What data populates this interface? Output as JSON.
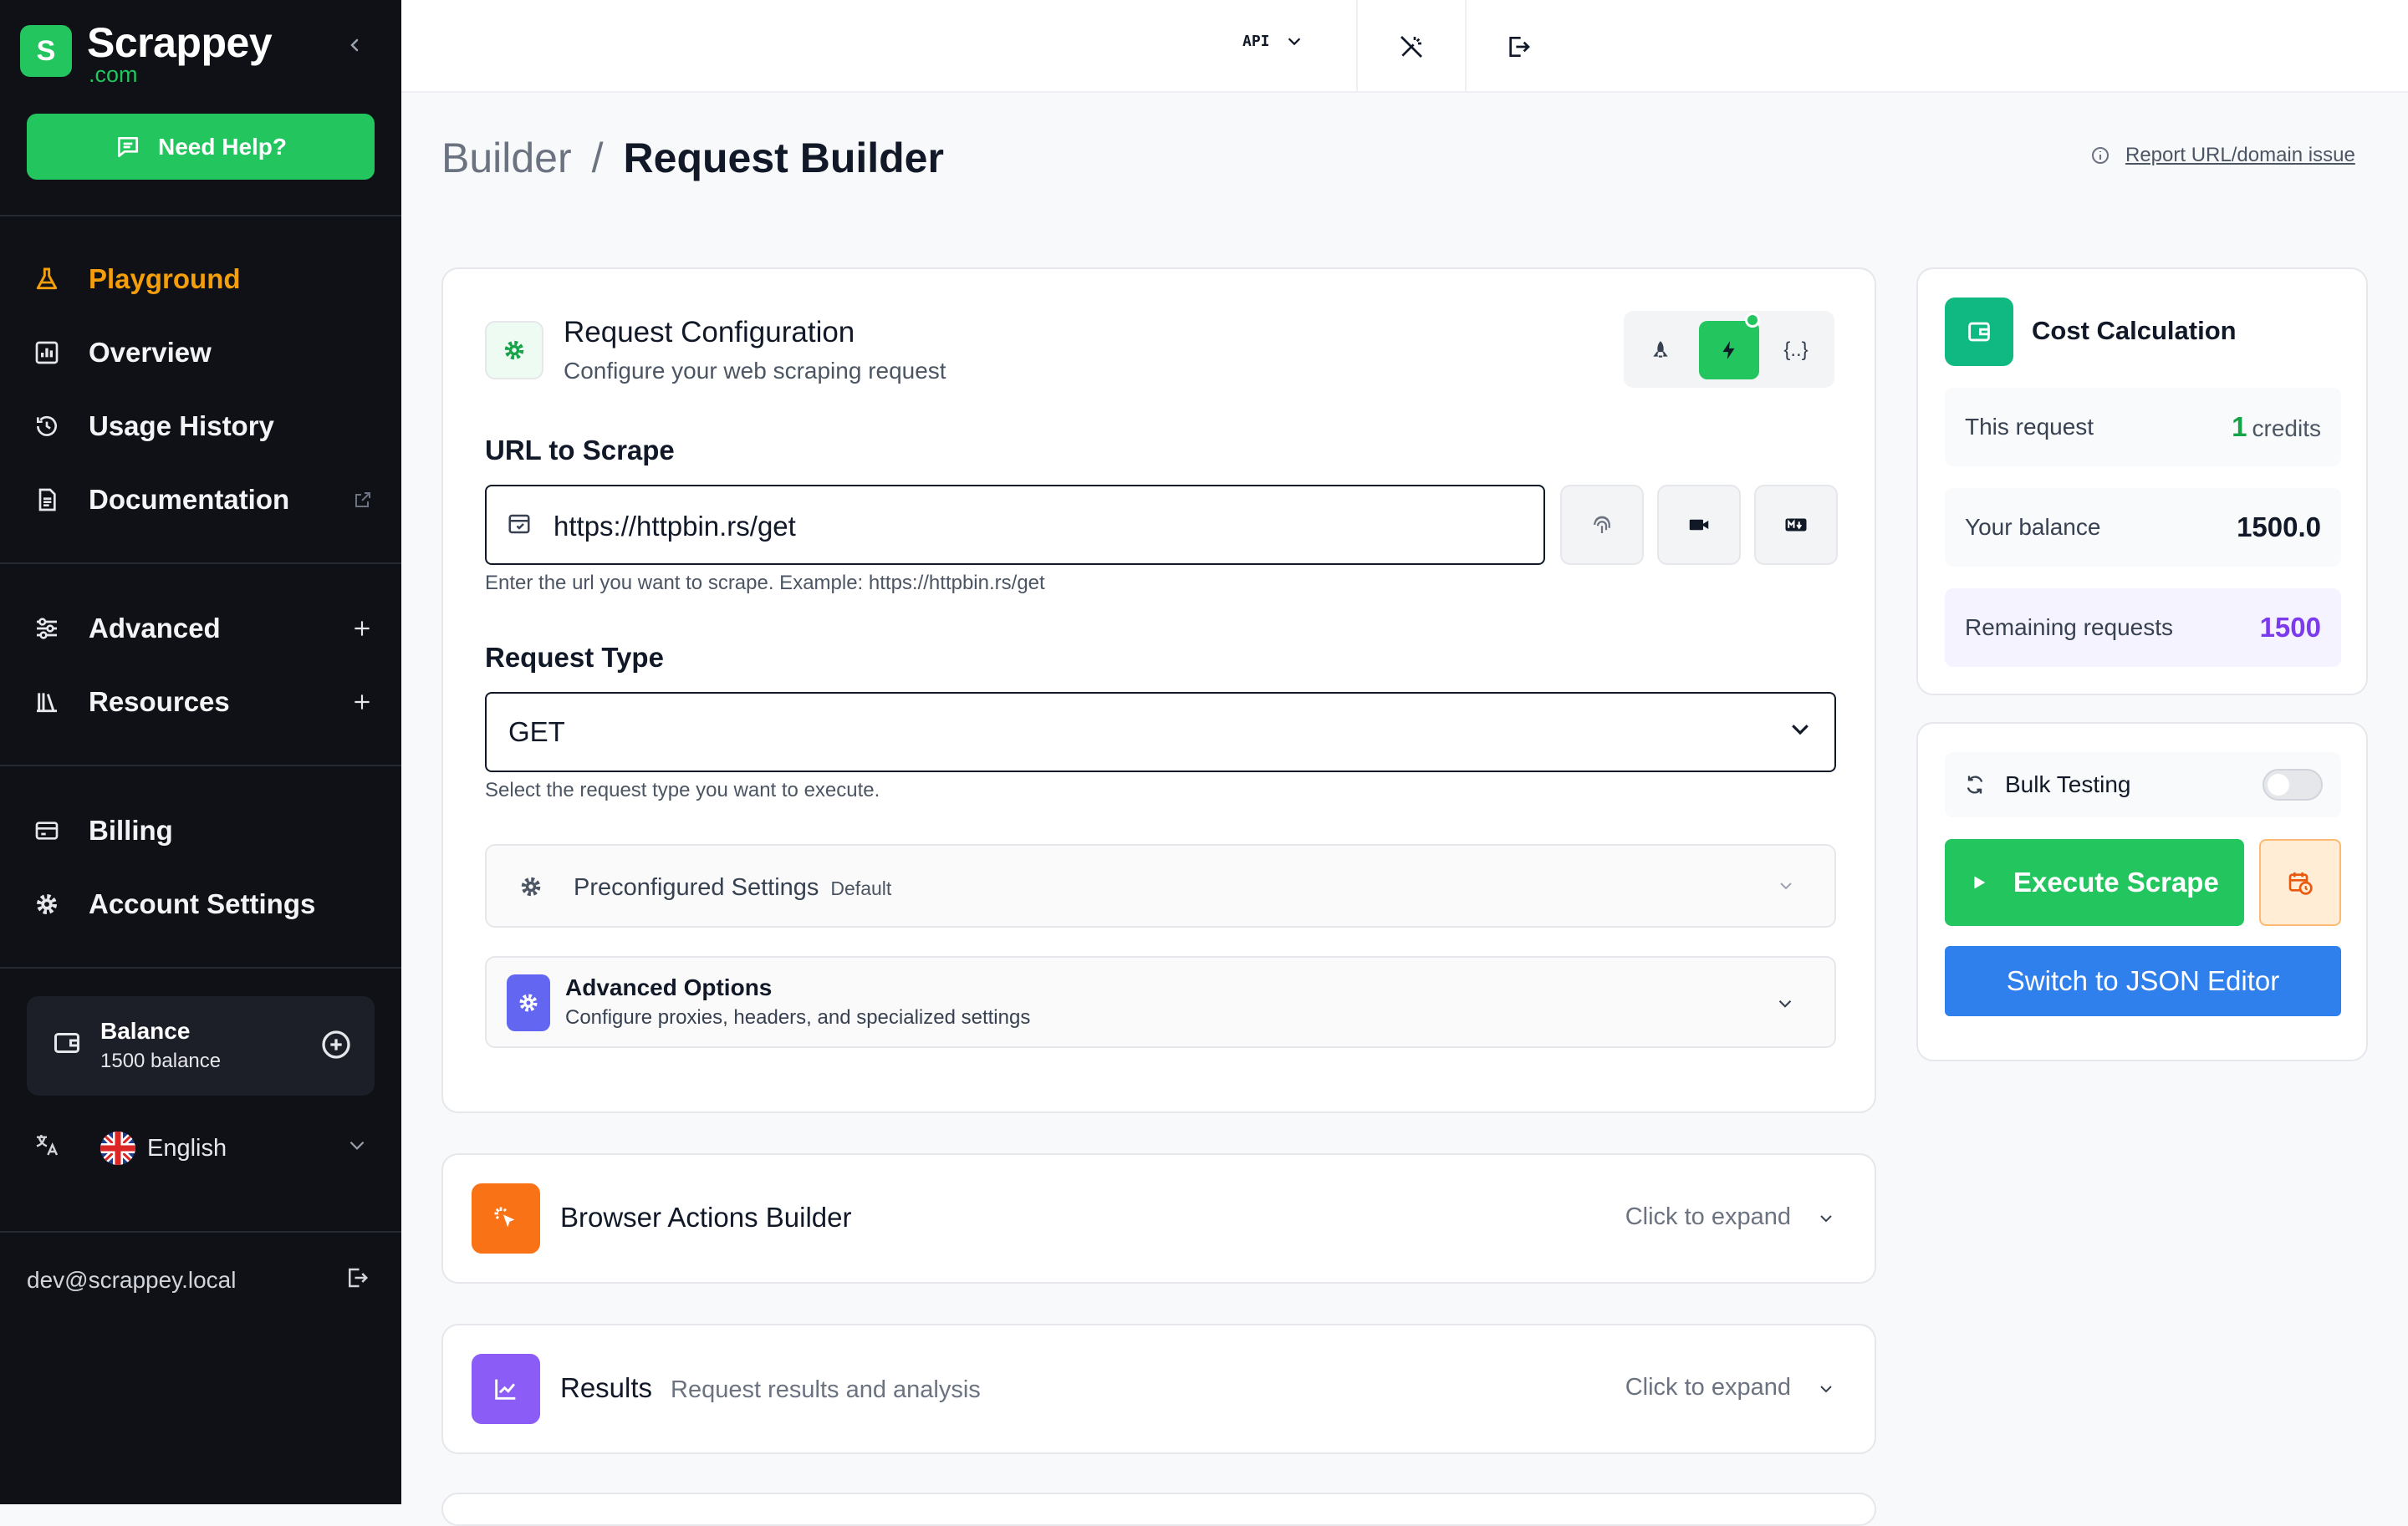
{
  "brand": {
    "name": "Scrappey",
    "tld": ".com",
    "badge": "S",
    "accent": "#22c55e"
  },
  "sidebar": {
    "help_label": "Need Help?",
    "nav": [
      {
        "label": "Playground",
        "icon": "flask-icon",
        "active": true
      },
      {
        "label": "Overview",
        "icon": "bar-chart-icon"
      },
      {
        "label": "Usage History",
        "icon": "history-icon"
      },
      {
        "label": "Documentation",
        "icon": "document-icon"
      },
      {
        "label": "Advanced",
        "icon": "sliders-icon"
      },
      {
        "label": "Resources",
        "icon": "library-icon"
      },
      {
        "label": "Billing",
        "icon": "credit-card-icon"
      },
      {
        "label": "Account Settings",
        "icon": "gear-icon"
      }
    ],
    "balance": {
      "title": "Balance",
      "subtitle": "1500 balance"
    },
    "language": "English",
    "user_email": "dev@scrappey.local"
  },
  "topbar": {
    "api_label": "API"
  },
  "header": {
    "breadcrumb_parent": "Builder",
    "breadcrumb_sep": "/",
    "breadcrumb_current": "Request Builder",
    "report_link": "Report URL/domain issue"
  },
  "config": {
    "title": "Request Configuration",
    "subtitle": "Configure your web scraping request",
    "mode_json_label": "{..}",
    "url_label": "URL to Scrape",
    "url_value": "https://httpbin.rs/get",
    "url_hint": "Enter the url you want to scrape. Example: https://httpbin.rs/get",
    "type_label": "Request Type",
    "type_value": "GET",
    "type_hint": "Select the request type you want to execute.",
    "preconfigured": {
      "title": "Preconfigured Settings",
      "badge": "Default"
    },
    "advanced": {
      "title": "Advanced Options",
      "desc": "Configure proxies, headers, and specialized settings"
    }
  },
  "browser_actions": {
    "title": "Browser Actions Builder",
    "expand": "Click to expand"
  },
  "results": {
    "title": "Results",
    "desc": "Request results and analysis",
    "expand": "Click to expand"
  },
  "cost": {
    "title": "Cost Calculation",
    "this_request_label": "This request",
    "this_request_value": "1",
    "this_request_unit": "credits",
    "balance_label": "Your balance",
    "balance_value": "1500.0",
    "remaining_label": "Remaining requests",
    "remaining_value": "1500"
  },
  "execute": {
    "bulk_label": "Bulk Testing",
    "bulk_enabled": false,
    "execute_label": "Execute Scrape",
    "json_label": "Switch to JSON Editor"
  }
}
